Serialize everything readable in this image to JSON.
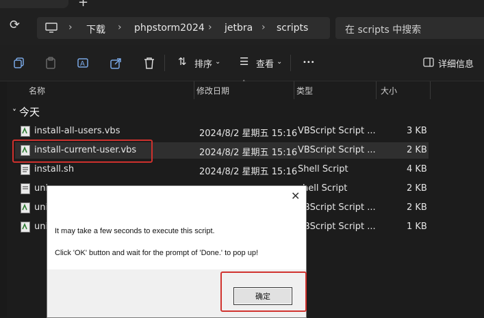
{
  "breadcrumb": [
    "下载",
    "phpstorm2024",
    "jetbra",
    "scripts"
  ],
  "search": {
    "placeholder": "在 scripts 中搜索"
  },
  "toolbar": {
    "sort_label": "排序",
    "view_label": "查看",
    "more_label": "•••",
    "details_label": "详细信息"
  },
  "columns": {
    "name": "名称",
    "date": "修改日期",
    "type": "类型",
    "size": "大小"
  },
  "group": {
    "label": "今天"
  },
  "files": [
    {
      "name": "install-all-users.vbs",
      "date": "2024/8/2 星期五 15:16",
      "type": "VBScript Script ...",
      "size": "3 KB"
    },
    {
      "name": "install-current-user.vbs",
      "date": "2024/8/2 星期五 15:16",
      "type": "VBScript Script ...",
      "size": "2 KB"
    },
    {
      "name": "install.sh",
      "date": "2024/8/2 星期五 15:16",
      "type": "Shell Script",
      "size": "4 KB"
    },
    {
      "name": "uni",
      "date": "",
      "type": "hell Script",
      "size": "2 KB"
    },
    {
      "name": "uni",
      "date": "",
      "type": "VBScript Script ...",
      "size": "2 KB"
    },
    {
      "name": "uni",
      "date": "",
      "type": "VBScript Script ...",
      "size": "1 KB"
    }
  ],
  "dialog": {
    "message_1": "It may take a few seconds to execute this script.",
    "message_2": "Click 'OK' button and wait for the prompt of 'Done.' to pop up!",
    "ok_label": "确定",
    "close_glyph": "✕"
  },
  "colors": {
    "highlight": "#d0312d",
    "background": "#1c1c1c"
  }
}
